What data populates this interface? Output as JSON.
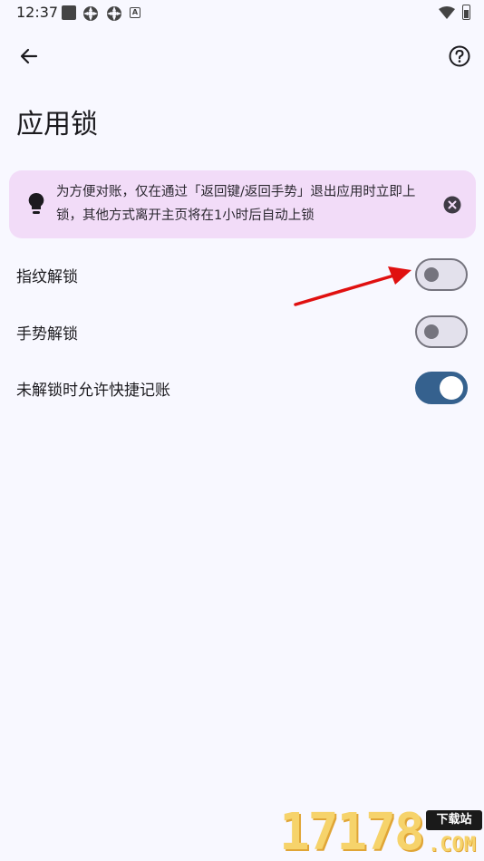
{
  "status_bar": {
    "time": "12:37",
    "icons": [
      "square-notification-icon",
      "gear-notification-icon",
      "gear-notification-icon",
      "a-notification-icon",
      "wifi-icon",
      "battery-icon"
    ],
    "a_glyph": "A"
  },
  "app_bar": {
    "back_icon": "arrow-left-icon",
    "help_icon": "help-circle-icon"
  },
  "page": {
    "title": "应用锁"
  },
  "tip": {
    "icon": "lightbulb-icon",
    "text": "为方便对账，仅在通过「返回键/返回手势」退出应用时立即上锁，其他方式离开主页将在1小时后自动上锁",
    "close_icon": "close-circle-icon"
  },
  "settings": [
    {
      "label": "指纹解锁",
      "enabled": false
    },
    {
      "label": "手势解锁",
      "enabled": false
    },
    {
      "label": "未解锁时允许快捷记账",
      "enabled": true
    }
  ],
  "watermark": {
    "digits": "17178",
    "badge": "下载站",
    "domain": ".COM"
  },
  "colors": {
    "background": "#f8f8ff",
    "tip_background": "#f2dcf8",
    "switch_on": "#35618e",
    "switch_off_outline": "#75747e",
    "annotation_arrow": "#e01010"
  }
}
